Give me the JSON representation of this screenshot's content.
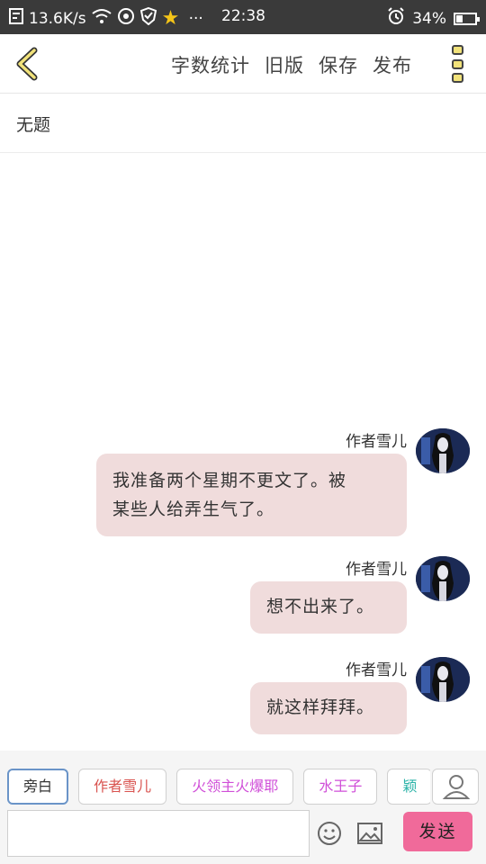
{
  "status_bar": {
    "speed": "13.6K/s",
    "time": "22:38",
    "battery": "34%",
    "battery_level": 0.34,
    "dots": "···",
    "icons": [
      "notification-icon",
      "wifi-icon",
      "disc-icon",
      "shield-icon",
      "star-app-icon",
      "alarm-icon",
      "battery-icon"
    ]
  },
  "toolbar": {
    "word_count_label": "字数统计",
    "old_version_label": "旧版",
    "save_label": "保存",
    "publish_label": "发布",
    "back_icon": "chevron-left-icon",
    "more_icon": "more-icon",
    "accent_color": "#f1e27a"
  },
  "title": "无题",
  "messages": [
    {
      "author": "作者雪儿",
      "text_line1": "我准备两个星期不更文了。被",
      "text_line2": "某些人给弄生气了。"
    },
    {
      "author": "作者雪儿",
      "text_line1": "想不出来了。"
    },
    {
      "author": "作者雪儿",
      "text_line1": "就这样拜拜。"
    }
  ],
  "roles": [
    {
      "label": "旁白",
      "color": "#333333"
    },
    {
      "label": "作者雪儿",
      "color": "#d9534f"
    },
    {
      "label": "火领主火爆耶",
      "color": "#d04fd8"
    },
    {
      "label": "水王子",
      "color": "#d04fd8"
    },
    {
      "label": "颖",
      "color": "#2bb3a8"
    }
  ],
  "bubble_color": "#f0dcdc",
  "send": {
    "label": "发送",
    "color": "#f06a9a"
  }
}
